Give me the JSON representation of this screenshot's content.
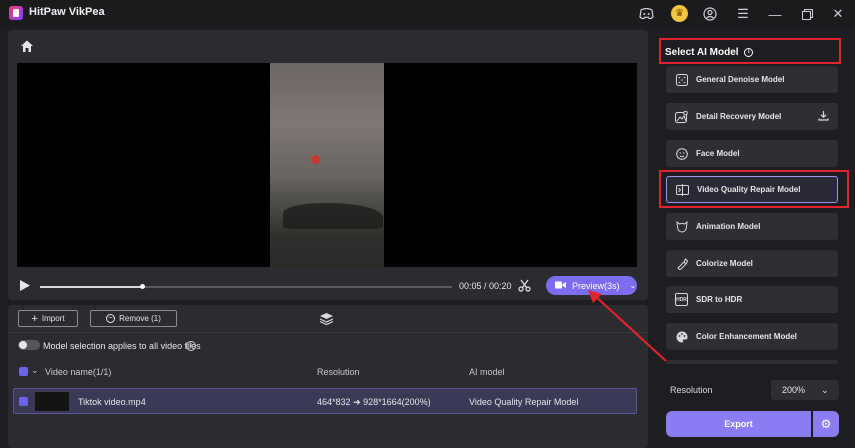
{
  "app": {
    "title": "HitPaw VikPea"
  },
  "titlebar_icons": [
    "discord-icon",
    "crown-icon",
    "account-icon",
    "menu-icon",
    "minimize-icon",
    "restore-icon",
    "close-icon"
  ],
  "player": {
    "time": "00:05 / 00:20",
    "progress": 0.25,
    "preview_label": "Preview(3s)"
  },
  "file_toolbar": {
    "import_label": "Import",
    "remove_label": "Remove (1)"
  },
  "model_toggle": {
    "label": "Model selection applies to all video files",
    "on": false
  },
  "file_table": {
    "columns": [
      "Video name(1/1)",
      "Resolution",
      "AI model"
    ],
    "rows": [
      {
        "name": "Tiktok video.mp4",
        "resolution": "464*832 ➜ 928*1664(200%)",
        "model": "Video Quality Repair Model",
        "checked": true
      }
    ]
  },
  "ai_panel": {
    "title": "Select AI Model",
    "models": [
      {
        "label": "General Denoise Model",
        "icon": "denoise-icon"
      },
      {
        "label": "Detail Recovery Model",
        "icon": "detail-recovery-icon"
      },
      {
        "label": "Face Model",
        "icon": "face-icon"
      },
      {
        "label": "Video Quality Repair Model",
        "icon": "quality-repair-icon",
        "selected": true
      },
      {
        "label": "Animation Model",
        "icon": "animation-icon"
      },
      {
        "label": "Colorize Model",
        "icon": "colorize-icon"
      },
      {
        "label": "SDR to HDR",
        "icon": "hdr-icon"
      },
      {
        "label": "Color Enhancement Model",
        "icon": "color-enhancement-icon"
      }
    ]
  },
  "output": {
    "resolution_label": "Resolution",
    "resolution_value": "200%",
    "export_label": "Export"
  },
  "colors": {
    "accent": "#8a7df3",
    "highlight": "#e0242d"
  }
}
